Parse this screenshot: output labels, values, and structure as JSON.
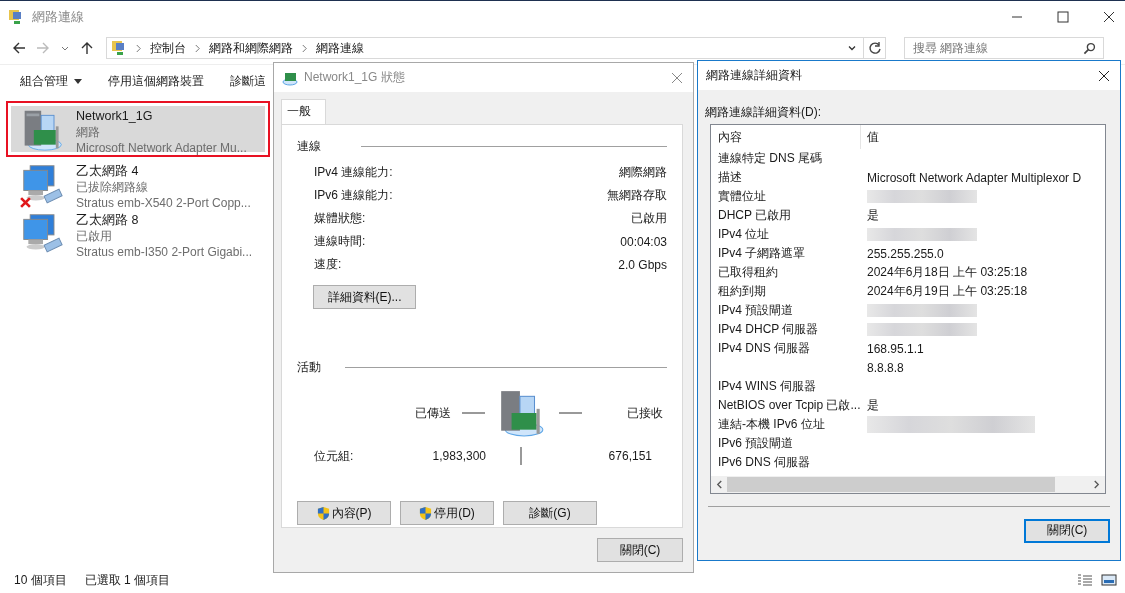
{
  "window": {
    "title": "網路連線"
  },
  "nav": {
    "breadcrumb": [
      "控制台",
      "網路和網際網路",
      "網路連線"
    ],
    "search": {
      "placeholder": "搜尋 網路連線"
    }
  },
  "toolbar": [
    {
      "label": "組合管理",
      "dropdown": true
    },
    {
      "label": "停用這個網路裝置"
    },
    {
      "label": "診斷這"
    }
  ],
  "connections": [
    {
      "name": "Network1_1G",
      "status": "網路",
      "adapter": "Microsoft Network Adapter Mu...",
      "kind": "adapter",
      "error": false,
      "selected": true
    },
    {
      "name": "乙太網路 4",
      "status": "已拔除網路線",
      "adapter": "Stratus emb-X540 2-Port Copp...",
      "kind": "ethernet",
      "error": true,
      "selected": false
    },
    {
      "name": "乙太網路 8",
      "status": "已啟用",
      "adapter": "Stratus emb-I350 2-Port Gigabi...",
      "kind": "ethernet",
      "error": false,
      "selected": false
    }
  ],
  "status_bar": {
    "item_count": "10 個項目",
    "selected_count": "已選取 1 個項目"
  },
  "status_dialog": {
    "title": "Network1_1G 狀態",
    "tabs": [
      {
        "label": "一般",
        "selected": true
      }
    ],
    "connection": {
      "heading": "連線",
      "rows": [
        {
          "label": "IPv4 連線能力:",
          "value": "網際網路"
        },
        {
          "label": "IPv6 連線能力:",
          "value": "無網路存取"
        },
        {
          "label": "媒體狀態:",
          "value": "已啟用"
        },
        {
          "label": "連線時間:",
          "value": "00:04:03"
        },
        {
          "label": "速度:",
          "value": "2.0 Gbps"
        }
      ]
    },
    "details_button": "詳細資料(E)...",
    "activity": {
      "heading": "活動",
      "sent_label": "已傳送",
      "received_label": "已接收",
      "bytes_label": "位元組:",
      "sent": "1,983,300",
      "received": "676,151"
    },
    "buttons": [
      {
        "label": "內容(P)",
        "shield": true
      },
      {
        "label": "停用(D)",
        "shield": true
      },
      {
        "label": "診斷(G)",
        "shield": false
      }
    ],
    "close_button": "關閉(C)"
  },
  "details_dialog": {
    "title": "網路連線詳細資料",
    "list_label": "網路連線詳細資料(D):",
    "columns": [
      "內容",
      "值"
    ],
    "rows": [
      {
        "property": "連線特定 DNS 尾碼"
      },
      {
        "property": "描述",
        "value": "Microsoft Network Adapter Multiplexor D"
      },
      {
        "property": "實體位址",
        "blurred": true
      },
      {
        "property": "DHCP 已啟用",
        "value": "是"
      },
      {
        "property": "IPv4 位址",
        "blurred": true
      },
      {
        "property": "IPv4 子網路遮罩",
        "value": "255.255.255.0"
      },
      {
        "property": "已取得租約",
        "value": "2024年6月18日 上午 03:25:18"
      },
      {
        "property": "租約到期",
        "value": "2024年6月19日 上午 03:25:18"
      },
      {
        "property": "IPv4 預設閘道",
        "blurred": true
      },
      {
        "property": "IPv4 DHCP 伺服器",
        "blurred": true
      },
      {
        "property": "IPv4 DNS 伺服器",
        "value": "168.95.1.1"
      },
      {
        "value": "8.8.8.8"
      },
      {
        "property": "IPv4 WINS 伺服器"
      },
      {
        "property": "NetBIOS over Tcpip 已啟...",
        "value": "是"
      },
      {
        "property": "連結-本機 IPv6 位址",
        "blurred": true
      },
      {
        "property": "IPv6 預設閘道"
      },
      {
        "property": "IPv6 DNS 伺服器"
      }
    ],
    "close_button": {
      "label": "關閉(C)",
      "focused": true
    }
  }
}
